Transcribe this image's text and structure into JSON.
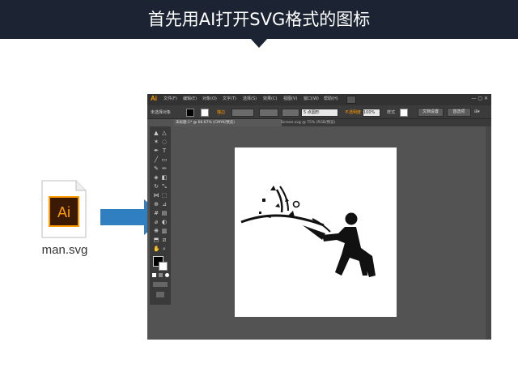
{
  "banner": {
    "title": "首先用AI打开SVG格式的图标"
  },
  "file": {
    "icon_text": "Ai",
    "label": "man.svg"
  },
  "arrow": {
    "icon": "right-arrow-icon",
    "color": "#2f7fc1"
  },
  "ai_window": {
    "logo": "Ai",
    "menu": [
      "文件(F)",
      "编辑(E)",
      "对象(O)",
      "文字(T)",
      "选择(S)",
      "效果(C)",
      "视图(V)",
      "窗口(W)",
      "帮助(H)"
    ],
    "control_bar": {
      "selection_label": "未选择对象",
      "stroke_label": "描边",
      "stroke_value": "",
      "brush_value": "5 点圆形",
      "opacity_label": "不透明度",
      "opacity_value": "100%",
      "style_label": "样式",
      "doc_setup_button": "文档设置",
      "preferences_button": "首选项"
    },
    "tabs": [
      {
        "label": "未标题-1* @ 66.67% (CMYK/预览)"
      },
      {
        "label": "Screen.svg @ 75% (RGB/预览)"
      }
    ],
    "colors": {
      "chrome": "#535353",
      "menubar": "#323232",
      "artboard": "#ffffff",
      "logo": "#ff9a00"
    },
    "artwork": {
      "icon": "party-popper-man-icon"
    }
  }
}
